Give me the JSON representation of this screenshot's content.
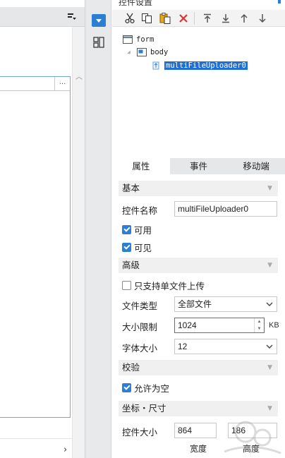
{
  "canvas": {
    "ellipsis": "..."
  },
  "panel": {
    "title": "控件设置",
    "toolbar": {
      "items": [
        {
          "icon": "cut-icon"
        },
        {
          "icon": "copy-icon"
        },
        {
          "icon": "paste-icon"
        },
        {
          "icon": "delete-icon"
        },
        {
          "icon": "move-top-icon"
        },
        {
          "icon": "move-bottom-icon"
        },
        {
          "icon": "move-up-icon"
        },
        {
          "icon": "move-down-icon"
        }
      ]
    },
    "tree": [
      {
        "label": "form",
        "icon": "form-icon"
      },
      {
        "label": "body",
        "icon": "body-icon"
      },
      {
        "label": "multiFileUploader0",
        "icon": "uploader-icon",
        "selected": true
      }
    ],
    "tabs": [
      "属性",
      "事件",
      "移动端"
    ],
    "active_tab": "属性"
  },
  "props": {
    "basic": {
      "title": "基本",
      "name_label": "控件名称",
      "name_value": "multiFileUploader0",
      "enabled_label": "可用",
      "visible_label": "可见"
    },
    "advanced": {
      "title": "高级",
      "single_file_label": "只支持单文件上传",
      "file_type_label": "文件类型",
      "file_type_value": "全部文件",
      "size_limit_label": "大小限制",
      "size_limit_value": "1024",
      "size_limit_unit": "KB",
      "font_size_label": "字体大小",
      "font_size_value": "12"
    },
    "validation": {
      "title": "校验",
      "allow_empty_label": "允许为空"
    },
    "geometry": {
      "title": "坐标・尺寸",
      "size_label": "控件大小",
      "width_value": "864",
      "height_value": "186",
      "width_caption": "宽度",
      "height_caption": "高度"
    }
  },
  "colors": {
    "accent": "#2d7fd6",
    "selection": "#1f6fd6",
    "delete": "#e03131"
  }
}
